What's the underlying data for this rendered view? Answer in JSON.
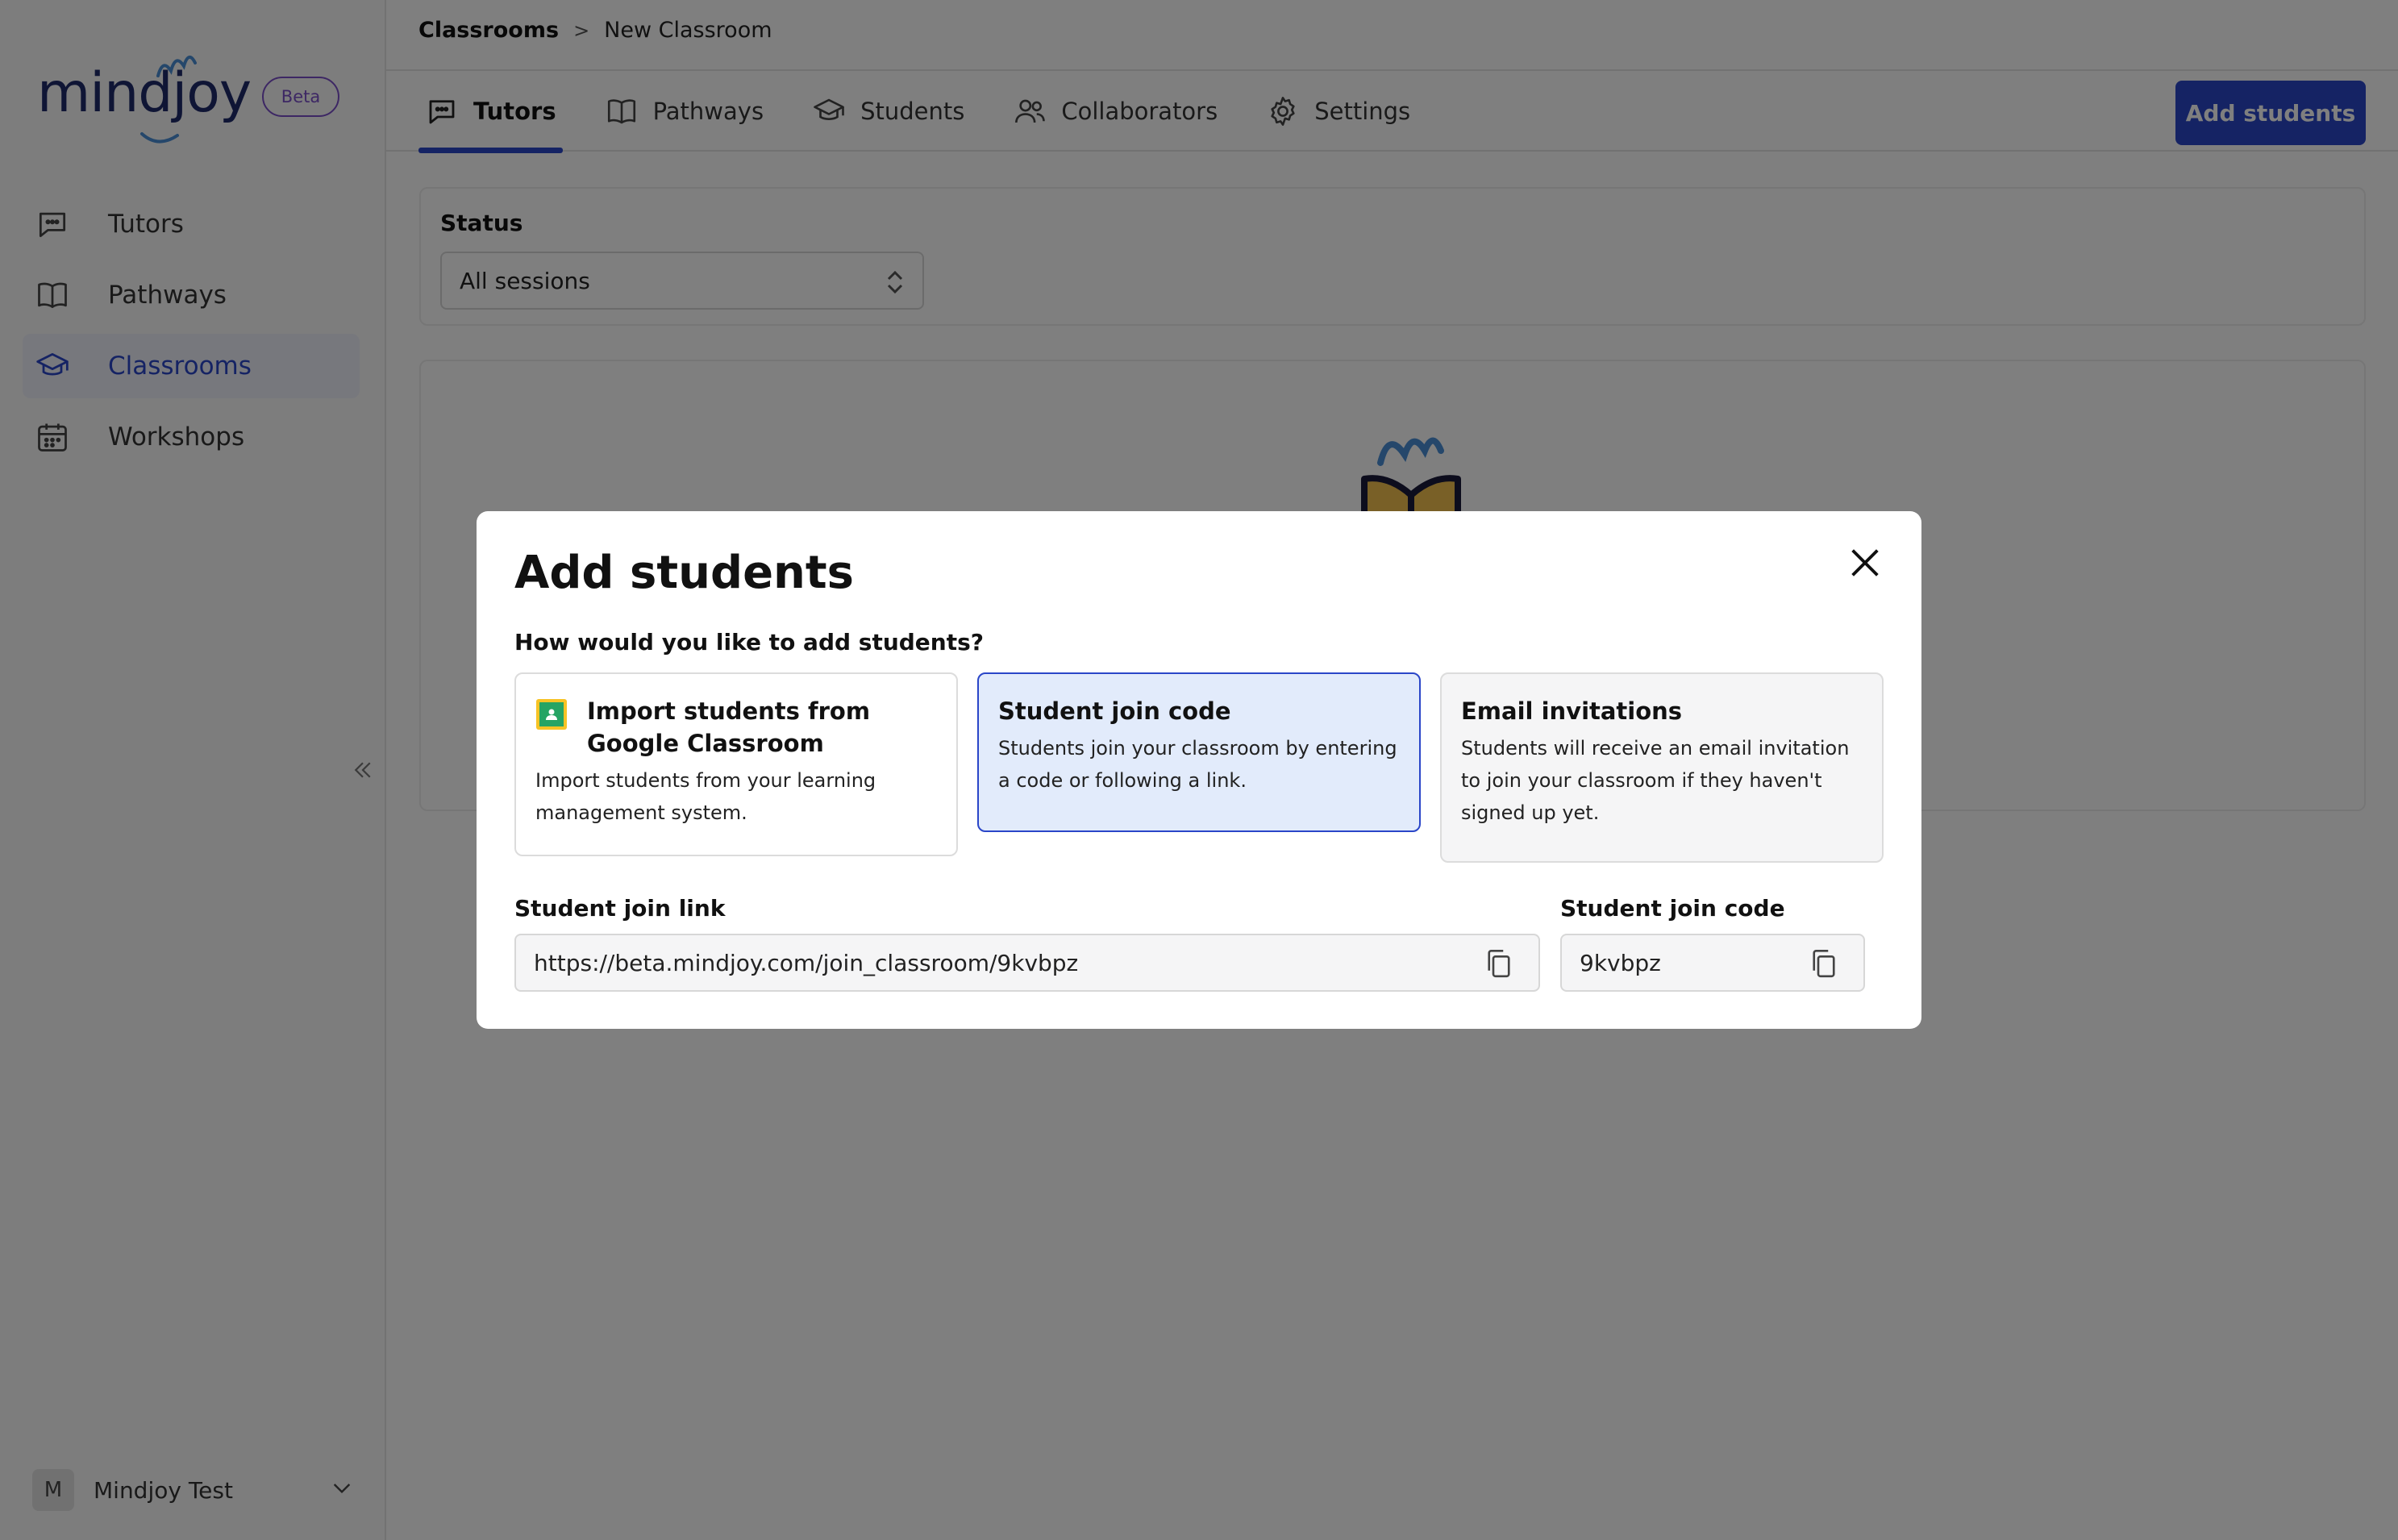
{
  "sidebar": {
    "logo_text": "mindjoy",
    "beta_badge": "Beta",
    "items": [
      {
        "label": "Tutors",
        "icon": "chat-bubble-icon",
        "active": false
      },
      {
        "label": "Pathways",
        "icon": "book-open-icon",
        "active": false
      },
      {
        "label": "Classrooms",
        "icon": "graduation-cap-icon",
        "active": true
      },
      {
        "label": "Workshops",
        "icon": "calendar-icon",
        "active": false
      }
    ],
    "collapse_icon": "double-chevron-left-icon",
    "user": {
      "initial": "M",
      "name": "Mindjoy Test",
      "menu_icon": "chevron-down-icon"
    }
  },
  "breadcrumb": {
    "parent": "Classrooms",
    "separator": ">",
    "current": "New Classroom"
  },
  "tabs": [
    {
      "label": "Tutors",
      "icon": "chat-bubble-icon",
      "active": true
    },
    {
      "label": "Pathways",
      "icon": "book-open-icon",
      "active": false
    },
    {
      "label": "Students",
      "icon": "graduation-cap-icon",
      "active": false
    },
    {
      "label": "Collaborators",
      "icon": "users-icon",
      "active": false
    },
    {
      "label": "Settings",
      "icon": "gear-icon",
      "active": false
    }
  ],
  "header": {
    "add_students_label": "Add students"
  },
  "filter": {
    "label": "Status",
    "selected": "All sessions"
  },
  "modal": {
    "title": "Add students",
    "question": "How would you like to add students?",
    "options": [
      {
        "title": "Import students from Google Classroom",
        "desc": "Import students from your learning management system.",
        "icon": "google-classroom-icon",
        "selected": false
      },
      {
        "title": "Student join code",
        "desc": "Students join your classroom by entering a code or following a link.",
        "selected": true
      },
      {
        "title": "Email invitations",
        "desc": "Students will receive an email invitation to join your classroom if they haven't signed up yet.",
        "selected": false
      }
    ],
    "join_link": {
      "label": "Student join link",
      "value": "https://beta.mindjoy.com/join_classroom/9kvbpz"
    },
    "join_code": {
      "label": "Student join code",
      "value": "9kvbpz"
    }
  },
  "colors": {
    "accent": "#2a46c8",
    "selected_bg": "#e2ebfb",
    "beta": "#7b4fc9",
    "overlay": "rgba(0,0,0,0.5)"
  }
}
